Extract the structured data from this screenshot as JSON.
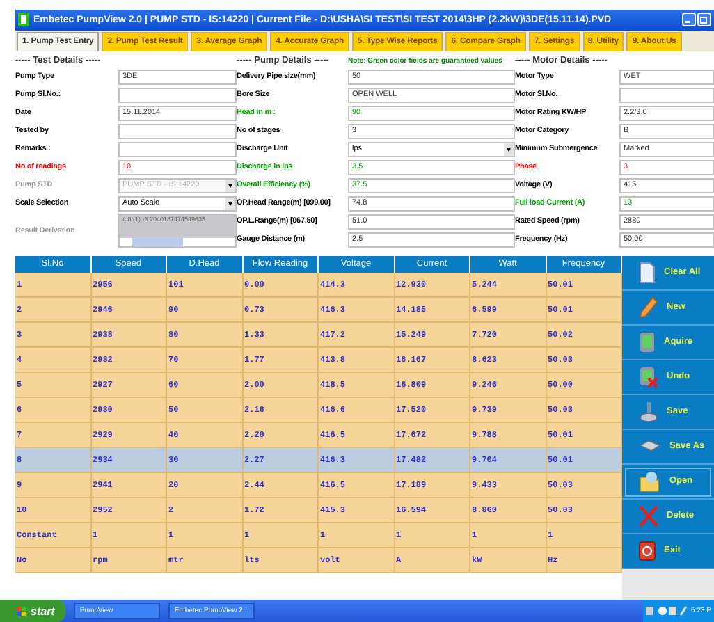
{
  "window": {
    "title": "Embetec PumpView 2.0 | PUMP STD - IS:14220 | Current File - D:\\USHA\\SI TEST\\SI TEST 2014\\3HP (2.2kW)\\3DE(15.11.14).PVD"
  },
  "tabs": [
    {
      "label": "1. Pump Test Entry",
      "selected": true
    },
    {
      "label": "2. Pump Test Result",
      "selected": false
    },
    {
      "label": "3. Average Graph",
      "selected": false
    },
    {
      "label": "4. Accurate Graph",
      "selected": false
    },
    {
      "label": "5. Type Wise Reports",
      "selected": false
    },
    {
      "label": "6. Compare Graph",
      "selected": false
    },
    {
      "label": "7. Settings",
      "selected": false
    },
    {
      "label": "8. Utility",
      "selected": false
    },
    {
      "label": "9. About Us",
      "selected": false
    }
  ],
  "test_details": {
    "heading": "----- Test Details -----",
    "fields": [
      {
        "label": "Pump Type",
        "kind": "text",
        "value": "3DE",
        "disabled": false
      },
      {
        "label": "Pump Sl.No.:",
        "kind": "text",
        "disabled": false
      },
      {
        "label": "Date",
        "kind": "text",
        "value": "15.11.2014",
        "disabled": false
      },
      {
        "label": "Tested by",
        "kind": "text",
        "disabled": false
      },
      {
        "label": "Remarks :",
        "kind": "text",
        "disabled": false
      },
      {
        "label": "No of readings",
        "kind": "text",
        "value": "10",
        "color": "#ff0000",
        "disabled": false
      },
      {
        "label": "Pump STD",
        "kind": "select",
        "value": "PUMP STD - IS:14220",
        "disabled": true
      },
      {
        "label": "Scale Selection",
        "kind": "select",
        "value": "Auto Scale",
        "disabled": false
      },
      {
        "label": "Result Derivation",
        "kind": "textarea",
        "value": "4.8.(1) -3.2040187474549635",
        "disabled": true
      }
    ]
  },
  "pump_details": {
    "heading": "----- Pump Details -----",
    "note": "Note: Green color fields are guaranteed values",
    "fields": [
      {
        "label": "Delivery Pipe size(mm)",
        "kind": "text",
        "value": "50",
        "disabled": false
      },
      {
        "label": "Bore Size",
        "kind": "text",
        "value": "OPEN WELL",
        "disabled": false
      },
      {
        "label": "Head in m :",
        "kind": "text",
        "value": "90",
        "color": "#00a000",
        "disabled": false
      },
      {
        "label": "No of stages",
        "kind": "text",
        "value": "3",
        "disabled": false
      },
      {
        "label": "Discharge Unit",
        "kind": "select",
        "value": "lps",
        "disabled": false
      },
      {
        "label": "Discharge in lps",
        "kind": "text",
        "value": "3.5",
        "color": "#00a000",
        "disabled": false
      },
      {
        "label": "Overall Efficiency (%)",
        "kind": "text",
        "value": "37.5",
        "color": "#00a000",
        "disabled": false
      },
      {
        "label": "OP.Head Range(m) [099.00]",
        "kind": "text",
        "value": "74.8",
        "disabled": false
      },
      {
        "label": "OP.L.Range(m) [067.50]",
        "kind": "text",
        "value": "51.0",
        "disabled": false
      },
      {
        "label": "Gauge Distance (m)",
        "kind": "text",
        "value": "2.5",
        "disabled": false
      }
    ]
  },
  "motor_details": {
    "heading": "----- Motor Details -----",
    "fields": [
      {
        "label": "Motor Type",
        "kind": "text",
        "value": "WET",
        "disabled": false
      },
      {
        "label": "Motor Sl.No.",
        "kind": "text",
        "disabled": false
      },
      {
        "label": "Motor Rating  KW/HP",
        "kind": "text",
        "value": "2.2/3.0",
        "disabled": false
      },
      {
        "label": "Motor Category",
        "kind": "text",
        "value": "B",
        "disabled": false
      },
      {
        "label": "Minimum Submergence",
        "kind": "text",
        "value": "Marked",
        "disabled": false
      },
      {
        "label": "Phase",
        "kind": "text",
        "value": "3",
        "color": "#ff0000",
        "disabled": false
      },
      {
        "label": "Voltage (V)",
        "kind": "text",
        "value": "415",
        "disabled": false
      },
      {
        "label": "Full load Current (A)",
        "kind": "text",
        "value": "13",
        "color": "#00a000",
        "disabled": false
      },
      {
        "label": "Rated Speed (rpm)",
        "kind": "text",
        "value": "2880",
        "disabled": false
      },
      {
        "label": "Frequency (Hz)",
        "kind": "text",
        "value": "50.00",
        "disabled": false
      }
    ]
  },
  "table": {
    "columns": [
      "Sl.No",
      "Speed",
      "D.Head",
      "Flow Reading",
      "Voltage",
      "Current",
      "Watt",
      "Frequency"
    ],
    "rows": [
      {
        "cells": [
          "1",
          "2956",
          "101",
          "0.00",
          "414.3",
          "12.930",
          "5.244",
          "50.01"
        ],
        "selected": false
      },
      {
        "cells": [
          "2",
          "2946",
          "90",
          "0.73",
          "416.3",
          "14.185",
          "6.599",
          "50.01"
        ],
        "selected": false
      },
      {
        "cells": [
          "3",
          "2938",
          "80",
          "1.33",
          "417.2",
          "15.249",
          "7.720",
          "50.02"
        ],
        "selected": false
      },
      {
        "cells": [
          "4",
          "2932",
          "70",
          "1.77",
          "413.8",
          "16.167",
          "8.623",
          "50.03"
        ],
        "selected": false
      },
      {
        "cells": [
          "5",
          "2927",
          "60",
          "2.00",
          "418.5",
          "16.809",
          "9.246",
          "50.00"
        ],
        "selected": false
      },
      {
        "cells": [
          "6",
          "2930",
          "50",
          "2.16",
          "416.6",
          "17.520",
          "9.739",
          "50.03"
        ],
        "selected": false
      },
      {
        "cells": [
          "7",
          "2929",
          "40",
          "2.20",
          "416.5",
          "17.672",
          "9.788",
          "50.01"
        ],
        "selected": false
      },
      {
        "cells": [
          "8",
          "2934",
          "30",
          "2.27",
          "416.3",
          "17.482",
          "9.704",
          "50.01"
        ],
        "selected": true
      },
      {
        "cells": [
          "9",
          "2941",
          "20",
          "2.44",
          "416.5",
          "17.189",
          "9.433",
          "50.03"
        ],
        "selected": false
      },
      {
        "cells": [
          "10",
          "2952",
          "2",
          "1.72",
          "415.3",
          "16.594",
          "8.860",
          "50.03"
        ],
        "selected": false
      },
      {
        "cells": [
          "Constant",
          "1",
          "1",
          "1",
          "1",
          "1",
          "1",
          "1"
        ],
        "selected": false
      },
      {
        "cells": [
          "No",
          "rpm",
          "mtr",
          "lts",
          "volt",
          "A",
          "kW",
          "Hz"
        ],
        "selected": false
      }
    ]
  },
  "actions": [
    {
      "label": "Clear All",
      "kind": "clear",
      "focused": false
    },
    {
      "label": "New",
      "kind": "new",
      "focused": false
    },
    {
      "label": "Aquire",
      "kind": "acquire",
      "focused": false
    },
    {
      "label": "Undo",
      "kind": "undo",
      "focused": false
    },
    {
      "label": "Save",
      "kind": "save",
      "focused": false
    },
    {
      "label": "Save As",
      "kind": "saveas",
      "focused": false
    },
    {
      "label": "Open",
      "kind": "open",
      "focused": true
    },
    {
      "label": "Delete",
      "kind": "delete",
      "focused": false
    },
    {
      "label": "Exit",
      "kind": "exit",
      "focused": false
    }
  ],
  "taskbar": {
    "start": "start",
    "items": [
      "PumpView",
      "Embetec PumpView 2..."
    ],
    "clock": "5:23 P"
  }
}
